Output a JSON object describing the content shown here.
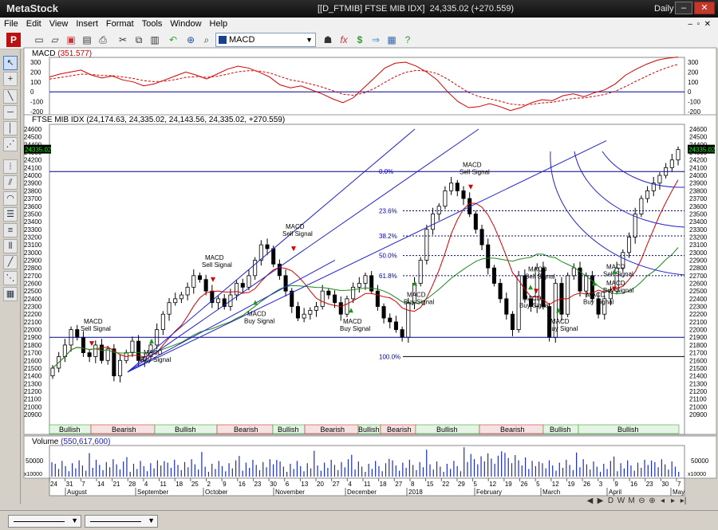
{
  "window": {
    "app_name": "MetaStock",
    "doc_title": "[[D_FTMIB] FTSE MIB IDX]",
    "doc_values": "24,335.02 (+270.559)",
    "period": "Daily"
  },
  "menu": [
    "File",
    "Edit",
    "View",
    "Insert",
    "Format",
    "Tools",
    "Window",
    "Help"
  ],
  "toolbar": {
    "indicator_select": "MACD",
    "icons": [
      "metastock-icon",
      "new-icon",
      "open-icon",
      "close-doc-icon",
      "save-icon",
      "print-icon",
      "cut-icon",
      "copy-icon",
      "paste-icon",
      "delete-icon",
      "undo-icon",
      "crosshair-icon",
      "zoom-icon",
      "indicator-icon",
      "fx-icon",
      "dollar-icon",
      "arrow-icon",
      "expert-icon",
      "help-icon"
    ]
  },
  "macd_panel": {
    "title": "MACD",
    "value": "(351.577)",
    "y_ticks": [
      "300",
      "200",
      "100",
      "0",
      "-100",
      "-200"
    ]
  },
  "price_panel": {
    "title": "FTSE MIB IDX",
    "values": "(24,174.63, 24,335.02, 24,143.56, 24,335.02, +270.559)",
    "last_price": "24335.02",
    "y_ticks": [
      "24600",
      "24500",
      "24400",
      "24300",
      "24200",
      "24100",
      "24000",
      "23900",
      "23800",
      "23700",
      "23600",
      "23500",
      "23400",
      "23300",
      "23200",
      "23100",
      "23000",
      "22900",
      "22800",
      "22700",
      "22600",
      "22500",
      "22400",
      "22300",
      "22200",
      "22100",
      "22000",
      "21900",
      "21800",
      "21700",
      "21600",
      "21500",
      "21400",
      "21300",
      "21200",
      "21100",
      "21000",
      "20900"
    ],
    "fib_labels": [
      "0.0%",
      "23.6%",
      "38.2%",
      "50.0%",
      "61.8%",
      "100.0%"
    ],
    "signals": [
      {
        "kind": "sell",
        "line1": "MACD",
        "line2": "Sell Signal"
      },
      {
        "kind": "buy",
        "line1": "MACD",
        "line2": "Buy Signal"
      },
      {
        "kind": "sell",
        "line1": "MACD",
        "line2": "Sell Signal"
      },
      {
        "kind": "buy",
        "line1": "MACD",
        "line2": "Buy Signal"
      },
      {
        "kind": "sell",
        "line1": "MACD",
        "line2": "Sell Signal"
      },
      {
        "kind": "buy",
        "line1": "MACD",
        "line2": "Buy Signal"
      },
      {
        "kind": "buy",
        "line1": "MACD",
        "line2": "Buy Signal"
      },
      {
        "kind": "sell",
        "line1": "MACD",
        "line2": "Sell Signal"
      },
      {
        "kind": "buy",
        "line1": "MACD",
        "line2": "Buy Signal"
      },
      {
        "kind": "sell",
        "line1": "MACD",
        "line2": "Sell Signal"
      },
      {
        "kind": "buy",
        "line1": "MACD",
        "line2": "Buy Signal"
      },
      {
        "kind": "buy",
        "line1": "MACD",
        "line2": "Buy Signal"
      },
      {
        "kind": "sell",
        "line1": "MACD",
        "line2": "Sell Signal"
      },
      {
        "kind": "buy",
        "line1": "MACD",
        "line2": "Buy Signal"
      }
    ],
    "trend_bands": [
      "Bullish",
      "Bearish",
      "Bullish",
      "Bearish",
      "Bullish",
      "Bearish",
      "Bullish",
      "Bearish",
      "Bullish",
      "Bearish",
      "Bullish",
      "Bullish"
    ]
  },
  "volume_panel": {
    "title": "Volume",
    "value": "(550,617,600)",
    "y_ticks": [
      "50000"
    ],
    "multiplier": "x10000"
  },
  "x_axis": {
    "day_labels": [
      "24",
      "31",
      "7",
      "14",
      "21",
      "28",
      "4",
      "11",
      "18",
      "25",
      "2",
      "9",
      "16",
      "23",
      "30",
      "6",
      "13",
      "20",
      "27",
      "4",
      "11",
      "18",
      "27",
      "8",
      "15",
      "22",
      "29",
      "5",
      "12",
      "19",
      "26",
      "5",
      "12",
      "19",
      "26",
      "3",
      "9",
      "16",
      "23",
      "30",
      "7"
    ],
    "month_labels": [
      "August",
      "September",
      "October",
      "November",
      "December",
      "2018",
      "February",
      "March",
      "April",
      "May"
    ]
  },
  "nav_buttons": [
    "D",
    "W",
    "M",
    "zoom-out",
    "zoom-in",
    "prev",
    "next"
  ]
}
